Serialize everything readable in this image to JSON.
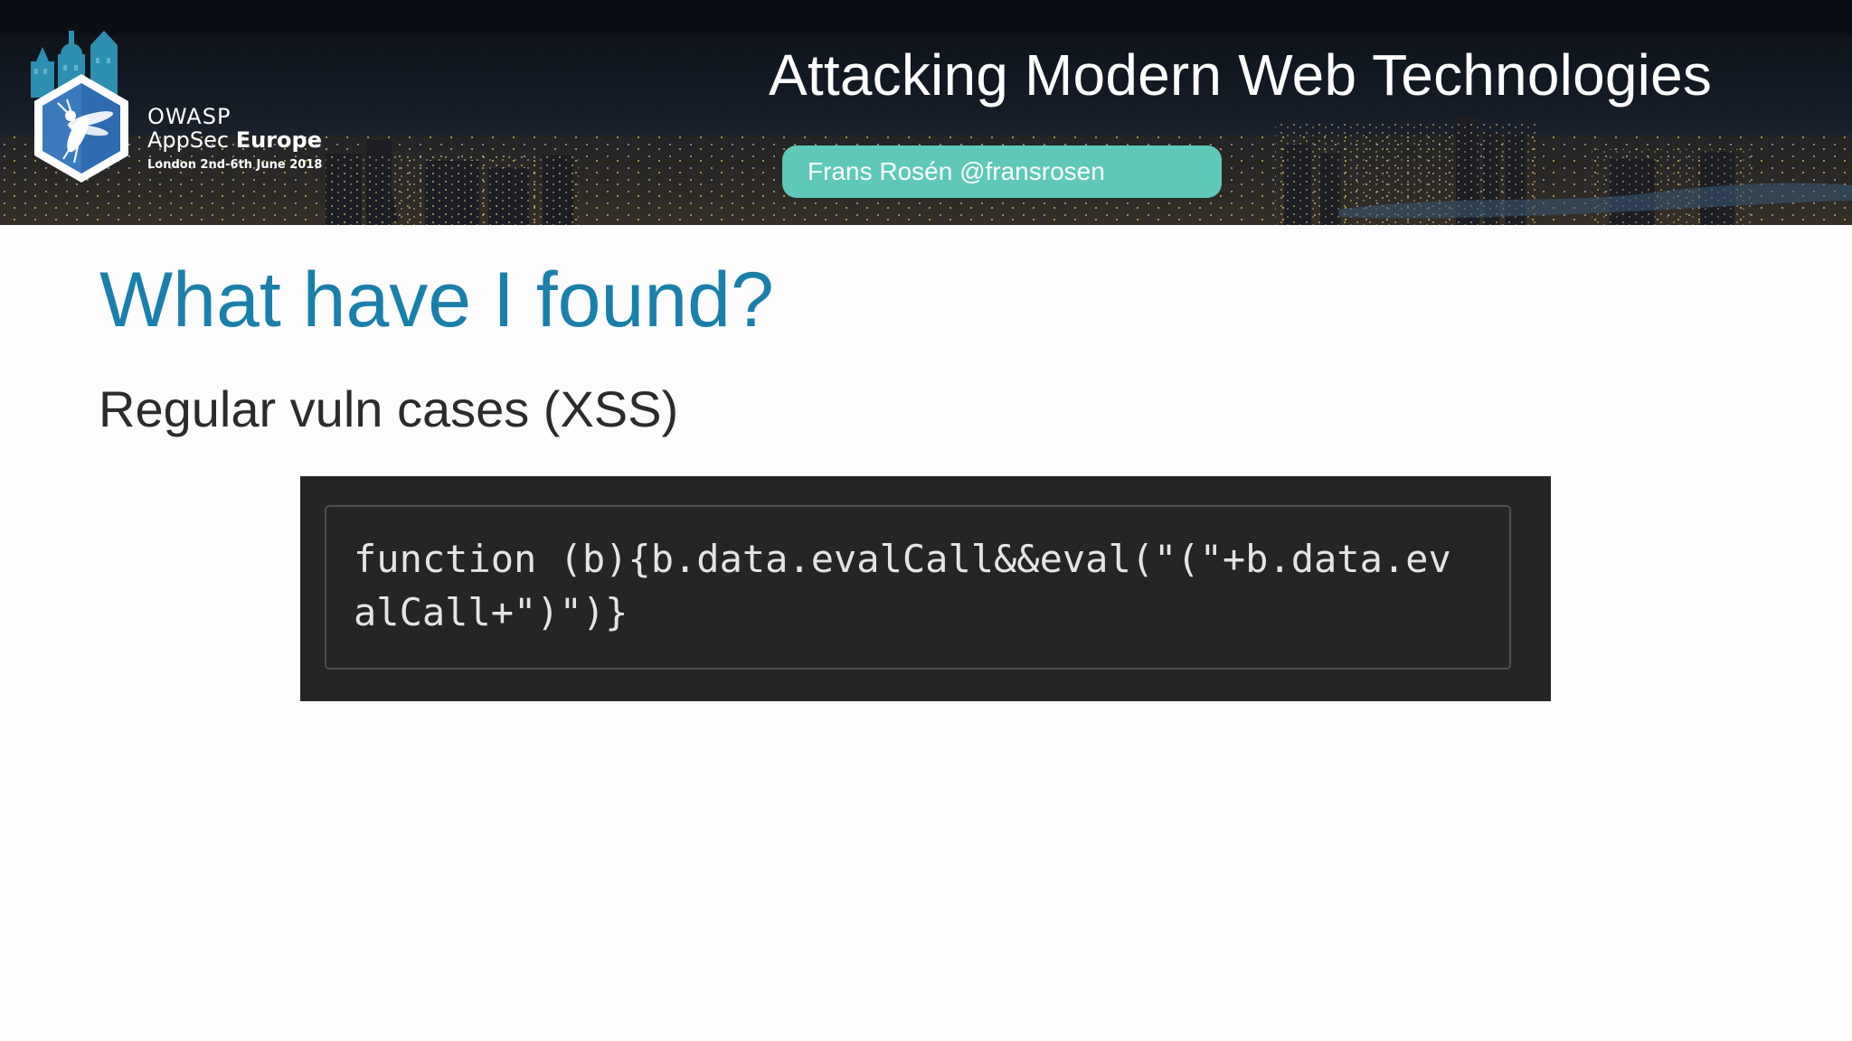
{
  "banner": {
    "talk_title": "Attacking Modern Web Technologies",
    "speaker": "Frans Rosén @fransrosen",
    "logo": {
      "org": "OWASP",
      "event_prefix": "AppSec",
      "event_name": "Europe",
      "date_line": "London 2nd-6th June 2018",
      "icon": "wasp-hexagon-icon"
    }
  },
  "slide": {
    "heading": "What have I found?",
    "subheading": "Regular vuln cases (XSS)",
    "code_lines": [
      "function (b){b.data.evalCall&&eval(\"(\"+b.data.ev",
      "alCall+\")\")}"
    ]
  },
  "colors": {
    "heading": "#1a7fab",
    "speaker_pill": "#5fc8b9",
    "code_background": "#252526",
    "page_background": "#fdfdfe"
  }
}
